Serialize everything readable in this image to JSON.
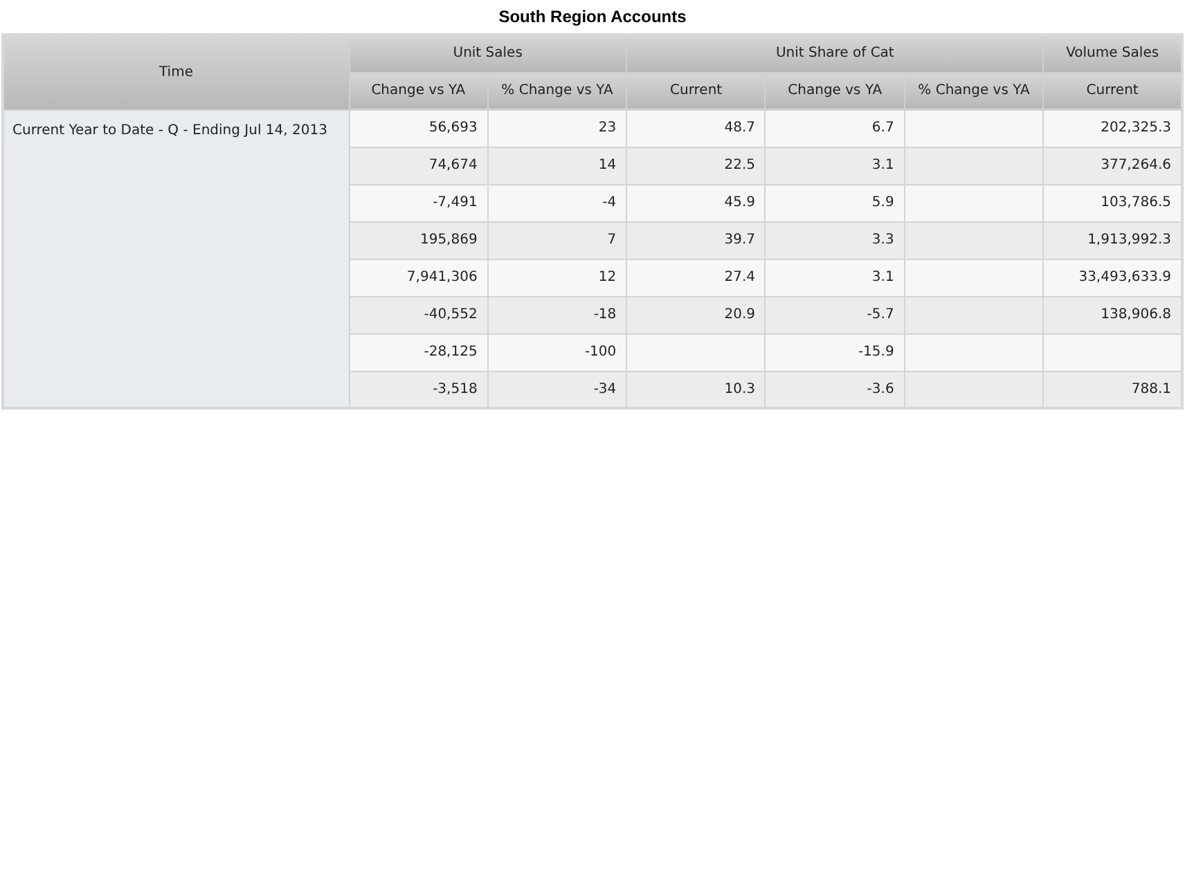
{
  "title": "South Region Accounts",
  "table": {
    "row_header": "Time",
    "groups": [
      {
        "label": "Unit Sales",
        "columns": [
          "Change vs YA",
          "% Change vs YA"
        ]
      },
      {
        "label": "Unit Share of Cat",
        "columns": [
          "Current",
          "Change vs YA",
          "% Change vs YA"
        ]
      },
      {
        "label": "Volume Sales",
        "columns": [
          "Current"
        ]
      }
    ],
    "row_label": "Current Year to Date - Q - Ending Jul 14, 2013",
    "rows": [
      [
        "56,693",
        "23",
        "48.7",
        "6.7",
        null,
        "202,325.3"
      ],
      [
        "74,674",
        "14",
        "22.5",
        "3.1",
        null,
        "377,264.6"
      ],
      [
        "-7,491",
        "-4",
        "45.9",
        "5.9",
        null,
        "103,786.5"
      ],
      [
        "195,869",
        "7",
        "39.7",
        "3.3",
        null,
        "1,913,992.3"
      ],
      [
        "7,941,306",
        "12",
        "27.4",
        "3.1",
        null,
        "33,493,633.9"
      ],
      [
        "-40,552",
        "-18",
        "20.9",
        "-5.7",
        null,
        "138,906.8"
      ],
      [
        "-28,125",
        "-100",
        null,
        "-15.9",
        null,
        null
      ],
      [
        "-3,518",
        "-34",
        "10.3",
        "-3.6",
        null,
        "788.1"
      ]
    ]
  }
}
